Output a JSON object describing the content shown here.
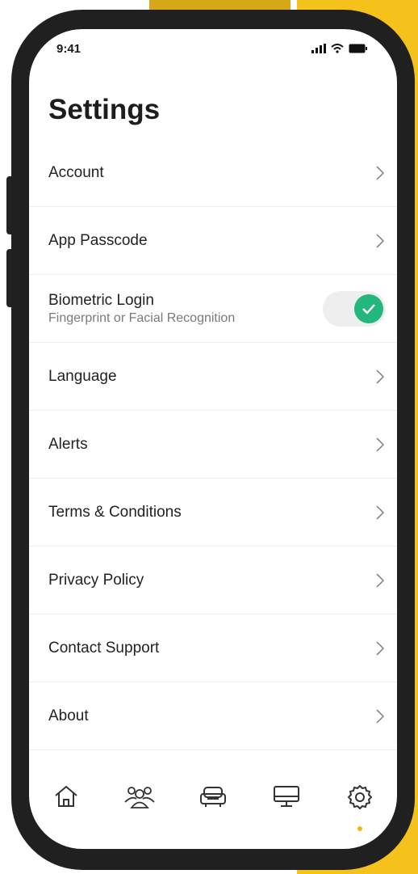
{
  "status_bar": {
    "time": "9:41"
  },
  "header": {
    "title": "Settings"
  },
  "settings": {
    "items": [
      {
        "label": "Account"
      },
      {
        "label": "App Passcode"
      },
      {
        "label": "Biometric Login",
        "sublabel": "Fingerprint or Facial Recognition",
        "enabled": true
      },
      {
        "label": "Language"
      },
      {
        "label": "Alerts"
      },
      {
        "label": "Terms & Conditions"
      },
      {
        "label": "Privacy Policy"
      },
      {
        "label": "Contact Support"
      },
      {
        "label": "About"
      }
    ]
  },
  "tab_bar": {
    "tabs": [
      {
        "icon": "home-icon"
      },
      {
        "icon": "users-icon"
      },
      {
        "icon": "car-icon"
      },
      {
        "icon": "monitor-icon"
      },
      {
        "icon": "gear-icon",
        "active": true
      }
    ]
  },
  "colors": {
    "accent_yellow": "#f5c21b",
    "toggle_green": "#23b67d",
    "phone_frame": "#202020"
  }
}
